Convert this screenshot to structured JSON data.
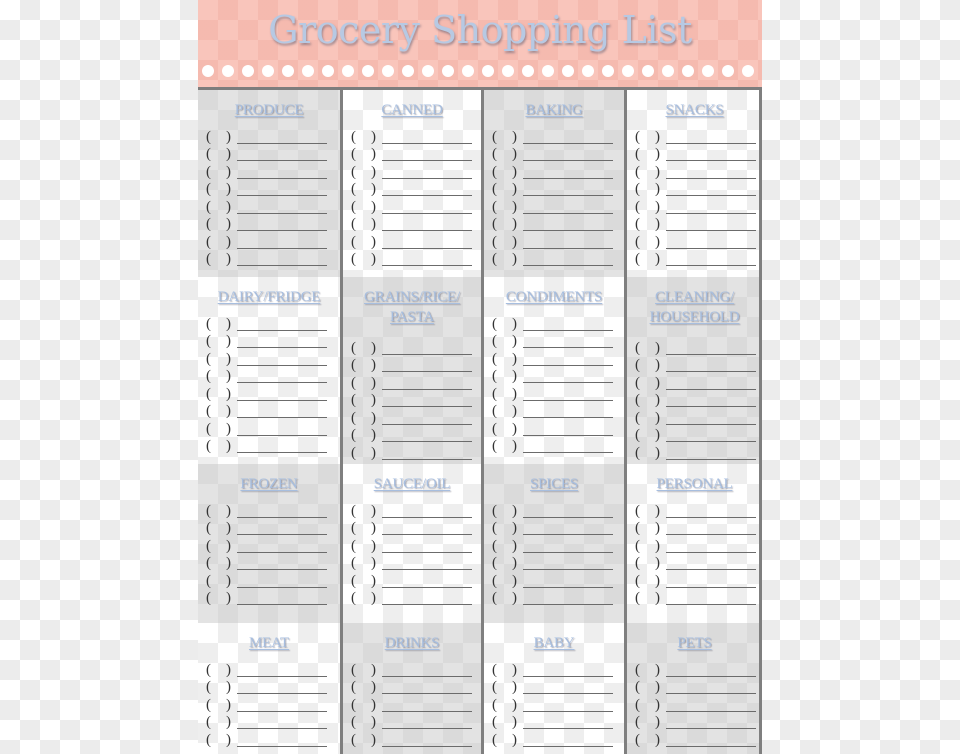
{
  "title": "Grocery Shopping List",
  "checkbox": {
    "open": "(",
    "close": ")"
  },
  "rows": [
    [
      {
        "label": "PRODUCE",
        "items": 8,
        "shade": "gray"
      },
      {
        "label": "CANNED",
        "items": 8,
        "shade": "white"
      },
      {
        "label": "BAKING",
        "items": 8,
        "shade": "gray"
      },
      {
        "label": "SNACKS",
        "items": 8,
        "shade": "white"
      }
    ],
    [
      {
        "label": "DAIRY/FRIDGE",
        "items": 8,
        "shade": "white"
      },
      {
        "label": "GRAINS/RICE/ PASTA",
        "items": 7,
        "shade": "gray"
      },
      {
        "label": "CONDIMENTS",
        "items": 8,
        "shade": "white"
      },
      {
        "label": "CLEANING/ HOUSEHOLD",
        "items": 7,
        "shade": "gray"
      }
    ],
    [
      {
        "label": "FROZEN",
        "items": 6,
        "shade": "gray"
      },
      {
        "label": "SAUCE/OIL",
        "items": 6,
        "shade": "white"
      },
      {
        "label": "SPICES",
        "items": 6,
        "shade": "gray"
      },
      {
        "label": "PERSONAL",
        "items": 6,
        "shade": "white"
      }
    ],
    [
      {
        "label": "MEAT",
        "items": 5,
        "shade": "white"
      },
      {
        "label": "DRINKS",
        "items": 5,
        "shade": "gray"
      },
      {
        "label": "BABY",
        "items": 5,
        "shade": "white"
      },
      {
        "label": "PETS",
        "items": 5,
        "shade": "gray"
      }
    ]
  ],
  "colors": {
    "header_bg": "#f9c5bb",
    "title_text": "#b7c9e3",
    "category_text": "#a7bedf",
    "divider": "#7f7f7f"
  }
}
